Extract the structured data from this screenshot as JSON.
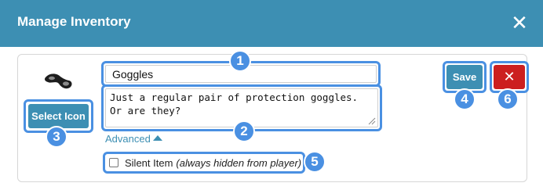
{
  "dialog": {
    "title": "Manage Inventory",
    "close_icon": "close-icon"
  },
  "item": {
    "icon": "goggles-icon",
    "name": "Goggles",
    "description_lines": [
      "Just a regular pair of protection goggles.",
      "Or are they?"
    ],
    "advanced_label": "Advanced",
    "silent_label": "Silent Item",
    "silent_note": "(always hidden from player)",
    "silent_checked": false
  },
  "buttons": {
    "select_icon": "Select Icon",
    "save": "Save",
    "delete_icon": "x-icon"
  },
  "callouts": [
    "1",
    "2",
    "3",
    "4",
    "5",
    "6"
  ],
  "colors": {
    "header": "#3d8fb3",
    "primary_button": "#3d8fb3",
    "delete_button": "#cc1f1f",
    "callout": "#4a90e2"
  }
}
